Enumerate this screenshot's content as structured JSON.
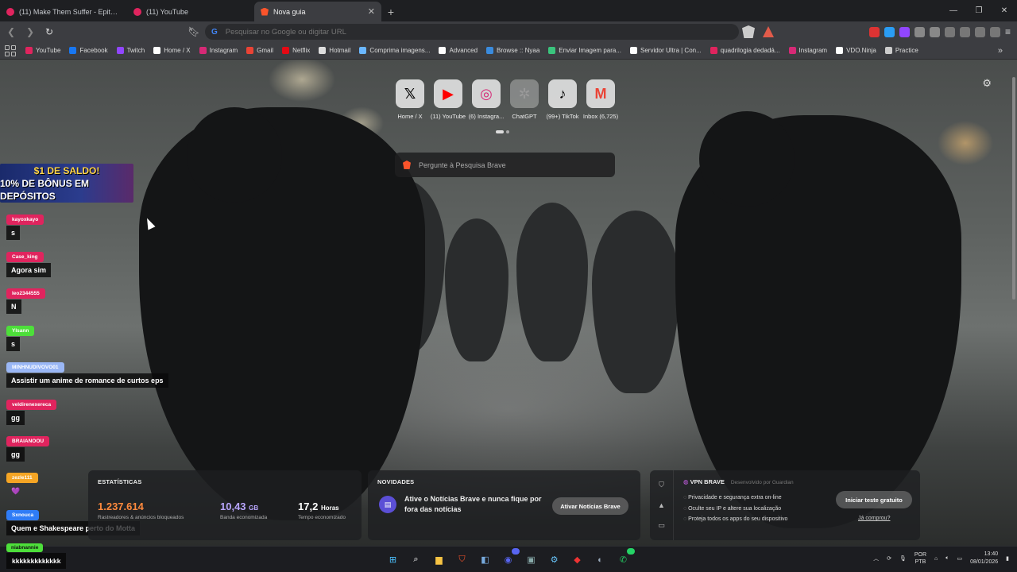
{
  "tabs": [
    {
      "title": "(11) Make Them Suffer - Epitaph (LYRIC",
      "icon": "youtube-icon"
    },
    {
      "title": "(11) YouTube",
      "icon": "youtube-icon"
    },
    {
      "title": "Nova guia",
      "icon": "brave-icon",
      "active": true
    }
  ],
  "toolbar": {
    "omnibox_placeholder": "Pesquisar no Google ou digitar URL"
  },
  "bookmarks": [
    {
      "label": "YouTube",
      "color": "#e0245e"
    },
    {
      "label": "Facebook",
      "color": "#1877f2"
    },
    {
      "label": "Twitch",
      "color": "#9146ff"
    },
    {
      "label": "Home / X",
      "color": "#ffffff"
    },
    {
      "label": "Instagram",
      "color": "#d62976"
    },
    {
      "label": "Gmail",
      "color": "#ea4335"
    },
    {
      "label": "Netflix",
      "color": "#e50914"
    },
    {
      "label": "Hotmail",
      "color": "#dddddd"
    },
    {
      "label": "Comprima imagens...",
      "color": "#6ab7ff"
    },
    {
      "label": "Advanced",
      "color": "#ffffff"
    },
    {
      "label": "Browse :: Nyaa",
      "color": "#3a8bdd"
    },
    {
      "label": "Enviar Imagem para...",
      "color": "#3ac47d"
    },
    {
      "label": "Servidor Ultra | Con...",
      "color": "#ffffff"
    },
    {
      "label": "quadrilogia dedadá...",
      "color": "#e0245e"
    },
    {
      "label": "Instagram",
      "color": "#d62976"
    },
    {
      "label": "VDO.Ninja",
      "color": "#ffffff"
    },
    {
      "label": "Practice",
      "color": "#cccccc"
    }
  ],
  "top_sites": [
    {
      "label": "Home / X",
      "glyph": "𝕏",
      "color": "#000000"
    },
    {
      "label": "(11) YouTube",
      "glyph": "▶",
      "color": "#ff0000"
    },
    {
      "label": "(6) Instagra...",
      "glyph": "◎",
      "color": "#d62976"
    },
    {
      "label": "ChatGPT",
      "glyph": "✲",
      "color": "#9a9a9a"
    },
    {
      "label": "(99+) TikTok",
      "glyph": "♪",
      "color": "#000000"
    },
    {
      "label": "Inbox (6,725)",
      "glyph": "M",
      "color": "#ea4335"
    }
  ],
  "search": {
    "placeholder": "Pergunte à Pesquisa Brave"
  },
  "ad": {
    "line1": "$1 DE SALDO!",
    "line2": "10% DE BÔNUS EM DEPÓSITOS"
  },
  "chat": [
    {
      "user": "kayoxkayo",
      "text": "s",
      "color": "#e0245e"
    },
    {
      "user": "Case_king",
      "text": "Agora sim",
      "color": "#e0245e"
    },
    {
      "user": "leo2344555",
      "text": "N",
      "color": "#e0245e"
    },
    {
      "user": "Ylsann",
      "text": "s",
      "color": "#4ddf3a"
    },
    {
      "user": "MINHNUDIVOVO01",
      "text": "Assistir um anime de romance de curtos eps",
      "color": "#9ab7f5"
    },
    {
      "user": "veldirenexereca",
      "text": "gg",
      "color": "#e0245e"
    },
    {
      "user": "BRAIANOOU",
      "text": "gg",
      "color": "#e0245e"
    },
    {
      "user": "zezle111",
      "text": "💜",
      "color": "#f5a524"
    },
    {
      "user": "Sxnouca",
      "text": "Quem e Shakespeare perto do Motta",
      "color": "#2f7cf6"
    }
  ],
  "chat_last": {
    "user": "niabnannie",
    "text": "kkkkkkkkkkkkk"
  },
  "stats": {
    "title": "ESTATÍSTICAS",
    "trackers": {
      "value": "1.237.614",
      "label": "Rastreadores & anúncios bloqueados"
    },
    "bandwidth": {
      "value": "10,43",
      "unit": "GB",
      "label": "Banda economizada"
    },
    "time": {
      "value": "17,2",
      "unit": "Horas",
      "label": "Tempo economizado"
    }
  },
  "news": {
    "title": "NOVIDADES",
    "text": "Ative o Notícias Brave e nunca fique por fora das notícias",
    "button": "Ativar Notícias Brave"
  },
  "vpn": {
    "title": "VPN BRAVE",
    "developer": "Desenvolvido por  Guardian",
    "items": [
      "Privacidade e segurança extra on-line",
      "Oculte seu IP e altere sua localização",
      "Proteja todos os apps do seu dispositivo"
    ],
    "button": "Iniciar teste gratuito",
    "link": "Já comprou?"
  },
  "taskbar": {
    "lang": [
      "POR",
      "PTB"
    ],
    "time": "13:40",
    "date": "08/01/2026",
    "discord_badge": "99",
    "whatsapp_badge": "54"
  }
}
